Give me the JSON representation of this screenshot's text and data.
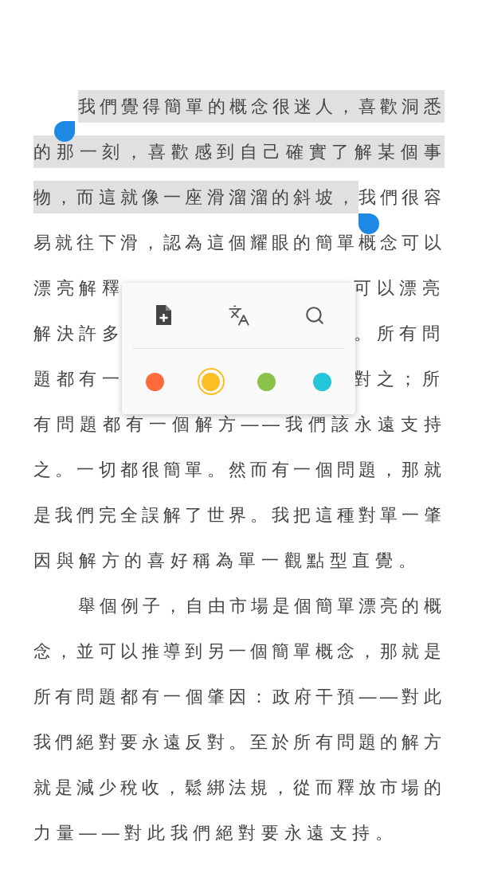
{
  "paragraphs": [
    {
      "lines": [
        {
          "segments": [
            {
              "text": "我們覺得簡單的概念很迷人，喜歡洞悉",
              "selected": true
            }
          ]
        },
        {
          "segments": [
            {
              "text": "的那一刻，喜歡感到自己確實了解某個事",
              "selected": true
            }
          ]
        },
        {
          "segments": [
            {
              "text": "物，而這就像一座滑溜溜的斜坡，",
              "selected": true
            },
            {
              "text": "我們很容",
              "selected": false
            }
          ]
        },
        {
          "segments": [
            {
              "text": "易就往下滑，認為這個耀眼的簡單概念可以",
              "selected": false
            }
          ]
        },
        {
          "covered": true,
          "segments": [
            {
              "text": "漂亮解釋",
              "selected": false
            },
            {
              "text": "可以漂亮",
              "selected": false
            }
          ]
        },
        {
          "covered": true,
          "segments": [
            {
              "text": "解決許多",
              "selected": false
            },
            {
              "text": "。所有問",
              "selected": false
            }
          ]
        },
        {
          "covered": true,
          "segments": [
            {
              "text": "題都有一",
              "selected": false
            },
            {
              "text": "對之；所",
              "selected": false
            }
          ]
        },
        {
          "segments": [
            {
              "text": "有問題都有一個解方——我們該永遠支持",
              "selected": false
            }
          ]
        },
        {
          "segments": [
            {
              "text": "之。一切都很簡單。然而有一個問題，那就",
              "selected": false
            }
          ]
        },
        {
          "segments": [
            {
              "text": "是我們完全誤解了世界。我把這種對單一肇",
              "selected": false
            }
          ]
        },
        {
          "segments": [
            {
              "text": "因與解方的喜好稱為單一觀點型直覺。",
              "selected": false
            }
          ]
        }
      ]
    },
    {
      "lines": [
        {
          "segments": [
            {
              "text": "舉個例子，自由市場是個簡單漂亮的概",
              "selected": false
            }
          ]
        },
        {
          "segments": [
            {
              "text": "念，並可以推導到另一個簡單概念，那就是",
              "selected": false
            }
          ]
        },
        {
          "segments": [
            {
              "text": "所有問題都有一個肇因：政府干預——對此",
              "selected": false
            }
          ]
        },
        {
          "segments": [
            {
              "text": "我們絕對要永遠反對。至於所有問題的解方",
              "selected": false
            }
          ]
        },
        {
          "segments": [
            {
              "text": "就是減少稅收，鬆綁法規，從而釋放市場的",
              "selected": false
            }
          ]
        },
        {
          "segments": [
            {
              "text": "力量——對此我們絕對要永遠支持。",
              "selected": false
            }
          ]
        }
      ]
    }
  ],
  "highlight_colors": [
    {
      "color": "#ff6a3d",
      "selected": false
    },
    {
      "color": "#fbbf24",
      "selected": true
    },
    {
      "color": "#8bc34a",
      "selected": false
    },
    {
      "color": "#26c6da",
      "selected": false
    }
  ]
}
